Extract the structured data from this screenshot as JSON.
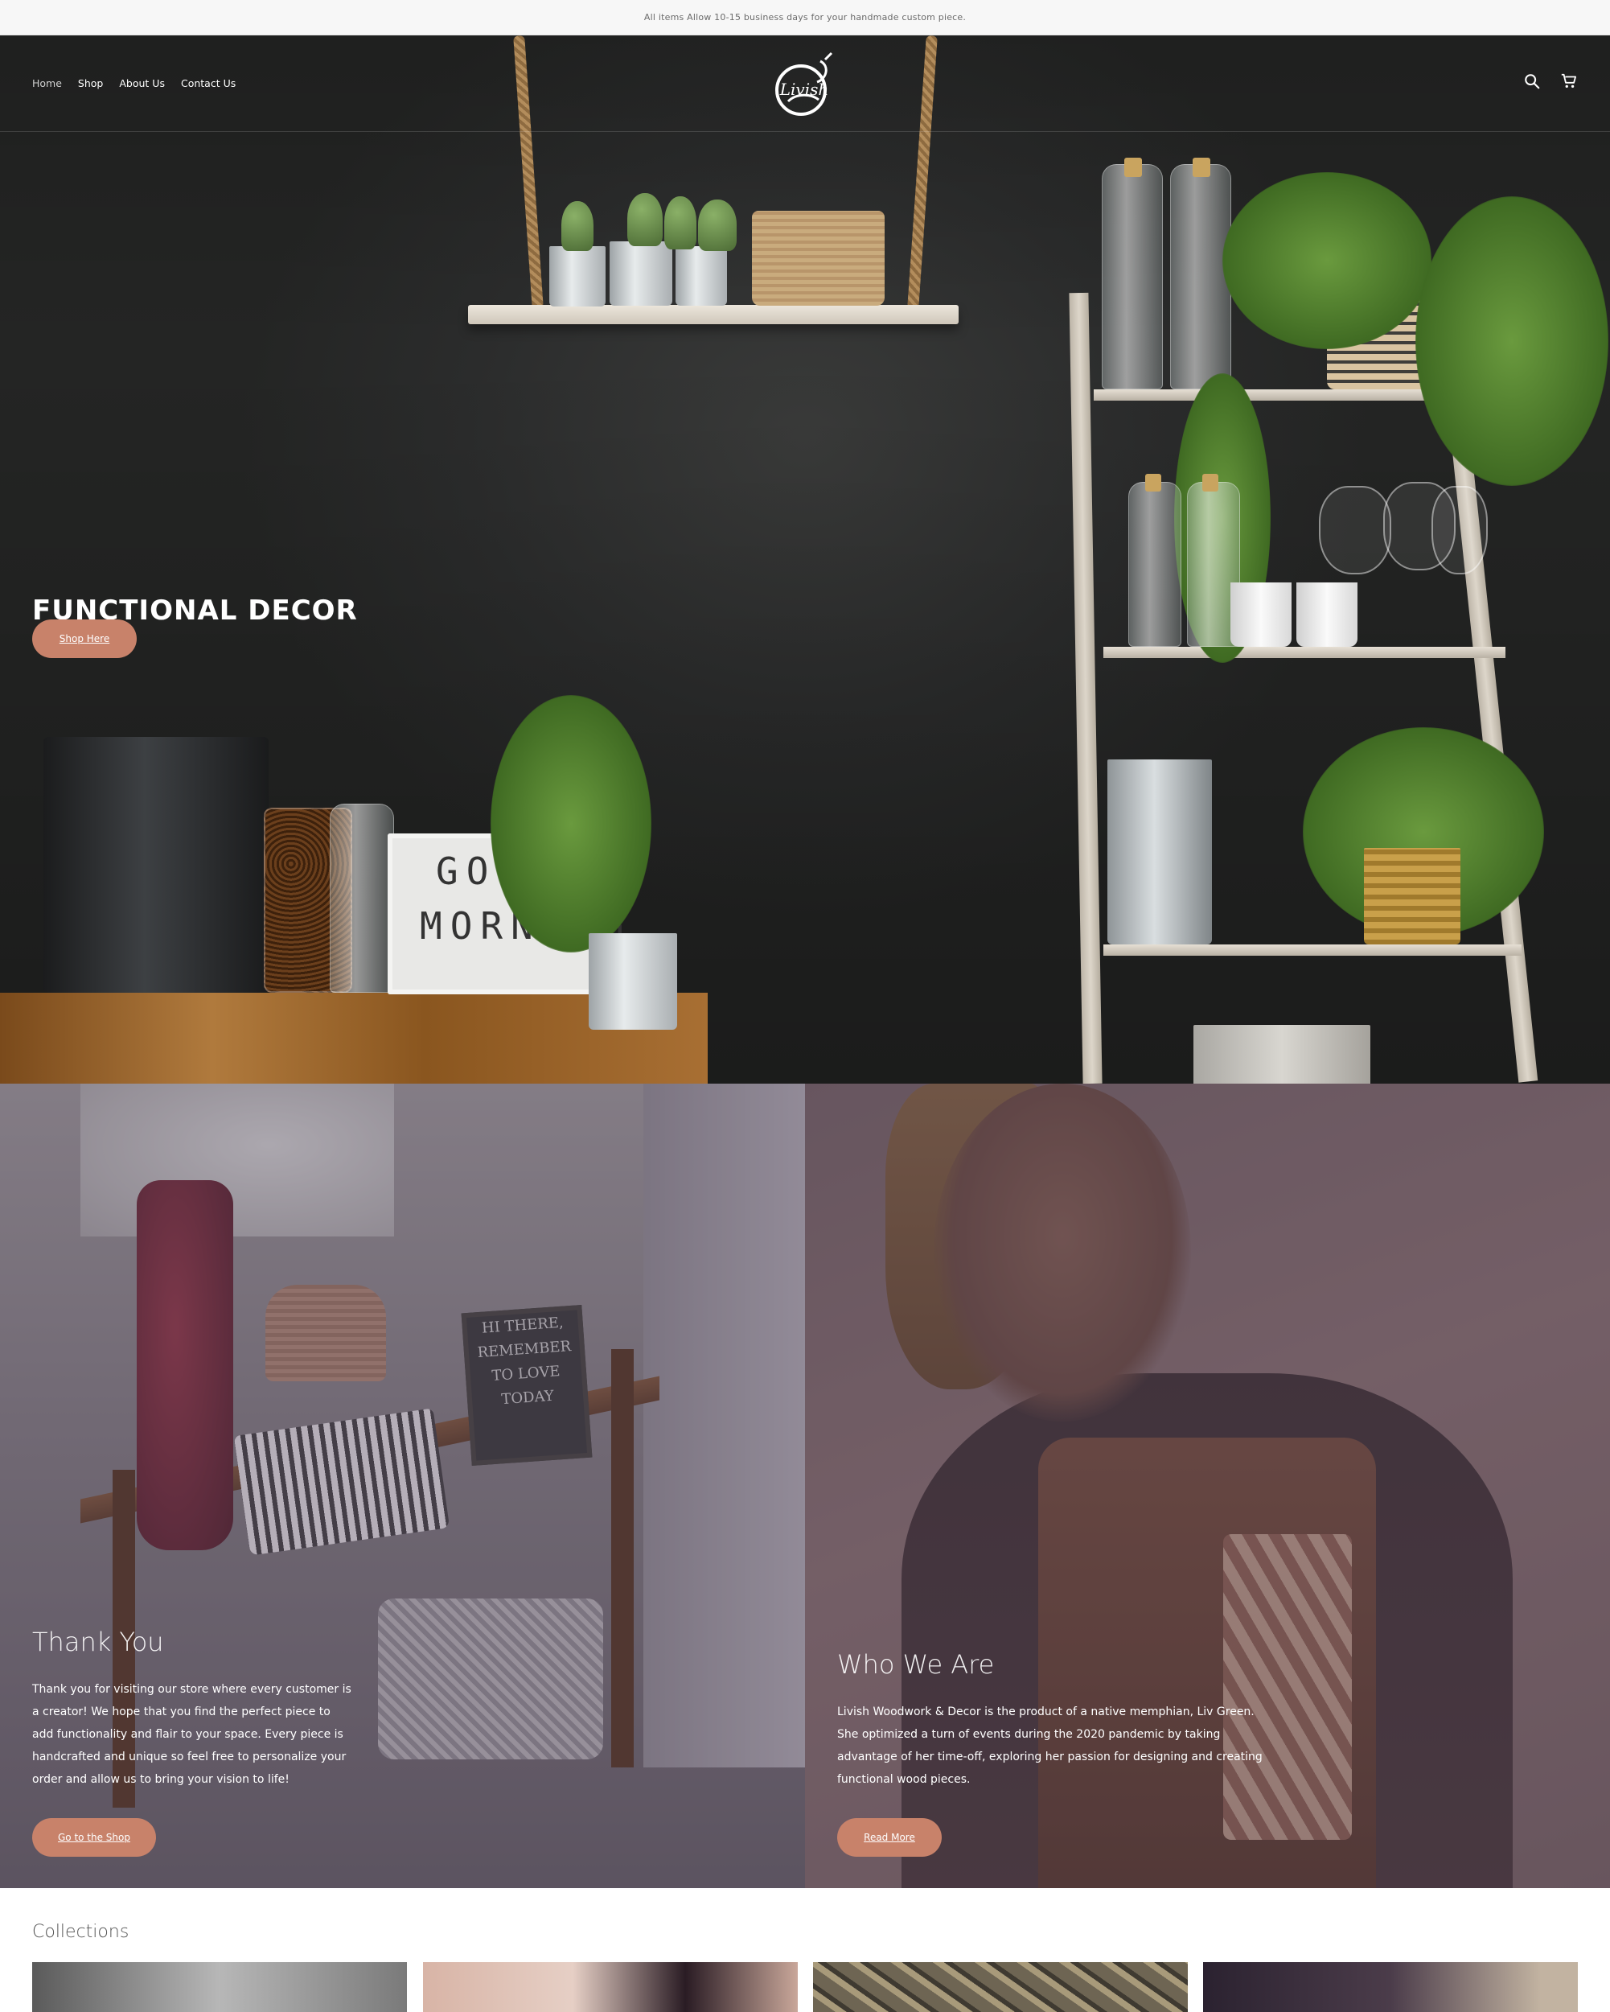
{
  "announcement": "All items Allow 10-15 business days for your handmade custom piece.",
  "nav": {
    "links": [
      {
        "label": "Home",
        "active": true
      },
      {
        "label": "Shop",
        "active": false
      },
      {
        "label": "About Us",
        "active": false
      },
      {
        "label": "Contact Us",
        "active": false
      }
    ],
    "logo_text": "Livish",
    "icons": [
      "search-icon",
      "cart-icon"
    ]
  },
  "hero": {
    "title": "FUNCTIONAL DECOR",
    "button": "Shop Here",
    "lightbox_lines": [
      "GOOD",
      "MORNING"
    ],
    "slides_total": 5,
    "active_slide": 1
  },
  "panels": {
    "left": {
      "title": "Thank You",
      "text": "Thank you for visiting our store where every customer is a creator! We hope that you find the perfect piece to add functionality and flair to your space. Every piece is handcrafted and unique so feel free to personalize your order and allow us to bring your vision to life!",
      "button": "Go to the Shop",
      "sign_lines": [
        "HI THERE,",
        "REMEMBER",
        "TO LOVE",
        "TODAY"
      ]
    },
    "right": {
      "title": "Who We Are",
      "text": "Livish Woodwork & Decor is the product of a native memphian, Liv Green. She optimized a turn of events during the 2020 pandemic by taking advantage of her time-off, exploring her passion for designing and creating functional wood pieces.",
      "button": "Read More"
    }
  },
  "collections": {
    "title": "Collections"
  },
  "colors": {
    "accent": "#c8826a",
    "hero_bg": "#2b2c2c",
    "announcement_bg": "#f7f7f7"
  }
}
